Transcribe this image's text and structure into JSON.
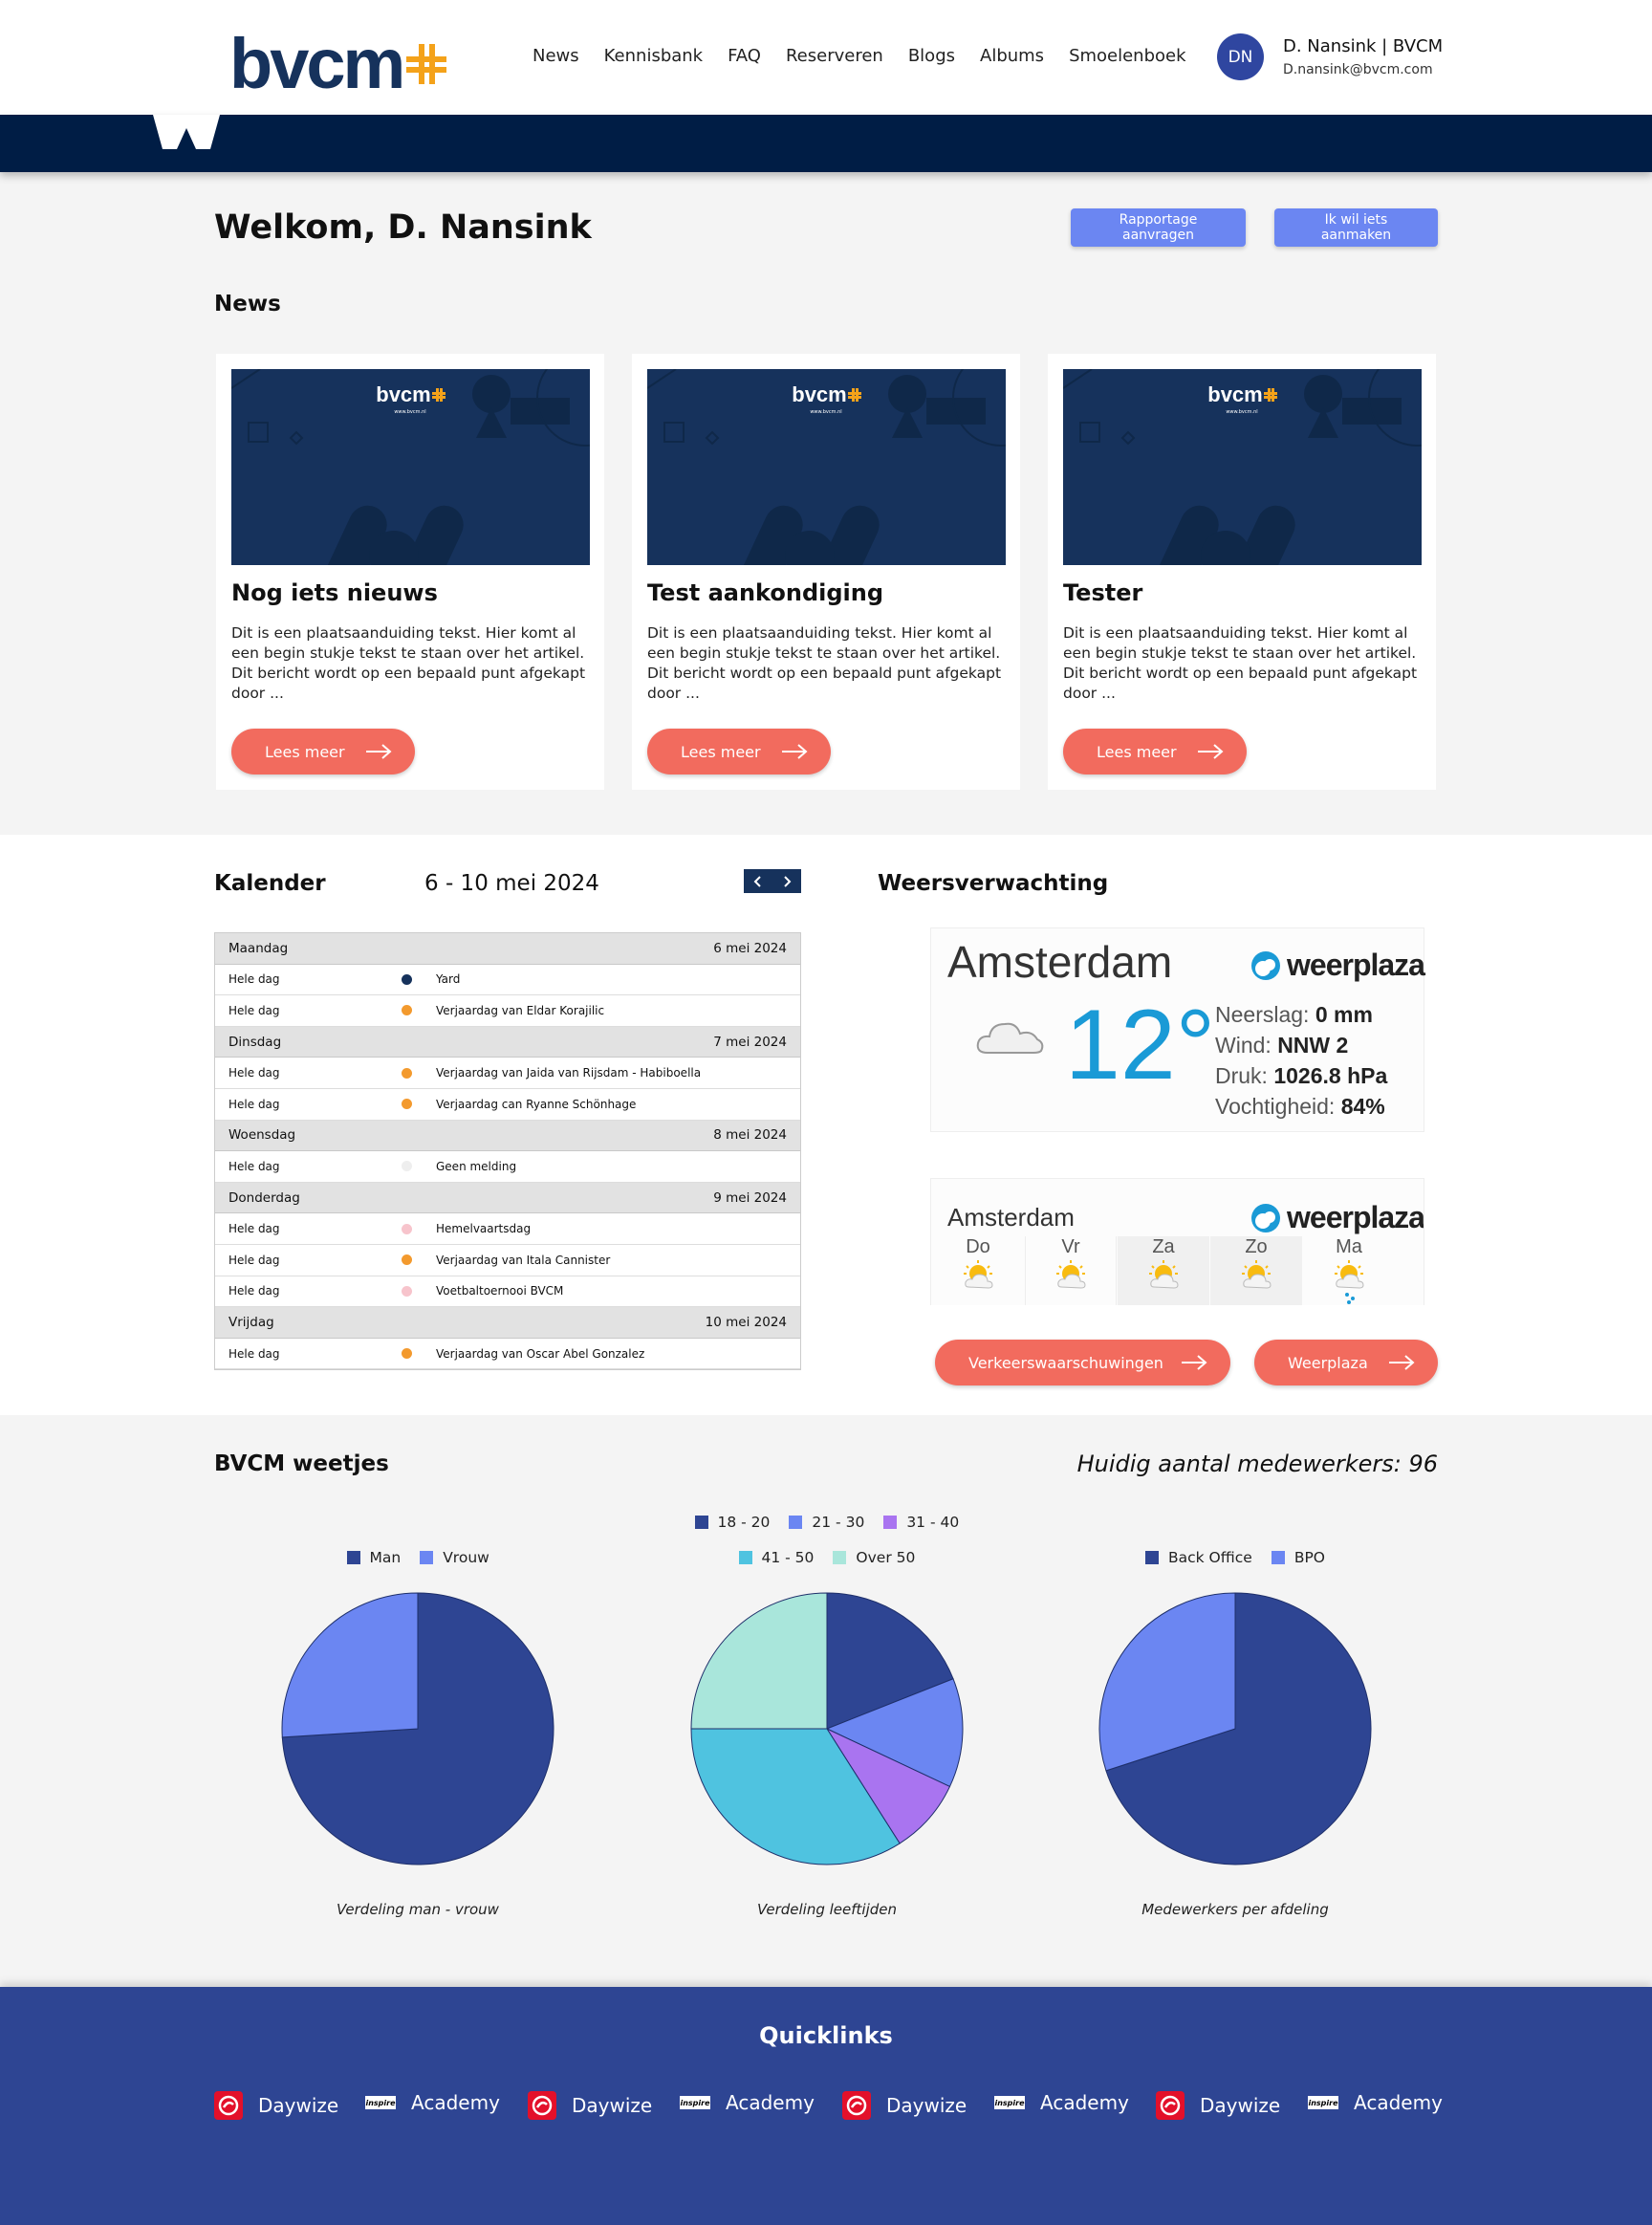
{
  "brand": {
    "logo_text": "bvcm",
    "accent": "#f4a21a",
    "navy": "#16325c"
  },
  "nav": [
    "News",
    "Kennisbank",
    "FAQ",
    "Reserveren",
    "Blogs",
    "Albums",
    "Smoelenboek"
  ],
  "user": {
    "initials": "DN",
    "name": "D. Nansink | BVCM",
    "email": "D.nansink@bvcm.com"
  },
  "welcome": {
    "title": "Welkom, D. Nansink",
    "btn_report": "Rapportage aanvragen",
    "btn_create": "Ik wil iets aanmaken"
  },
  "news": {
    "heading": "News",
    "read_more": "Lees meer",
    "image_caption": "www.bvcm.nl",
    "items": [
      {
        "title": "Nog iets nieuws",
        "text": "Dit is een plaatsaanduiding tekst. Hier komt al een begin stukje tekst te staan over het artikel. Dit bericht wordt op een bepaald punt afgekapt door ..."
      },
      {
        "title": "Test aankondiging",
        "text": "Dit is een plaatsaanduiding tekst. Hier komt al een begin stukje tekst te staan over het artikel. Dit bericht wordt op een bepaald punt afgekapt door ..."
      },
      {
        "title": "Tester",
        "text": "Dit is een plaatsaanduiding tekst. Hier komt al een begin stukje tekst te staan over het artikel. Dit bericht wordt op een bepaald punt afgekapt door ..."
      }
    ]
  },
  "calendar": {
    "heading": "Kalender",
    "range": "6 - 10 mei 2024",
    "rows": [
      {
        "type": "day",
        "day": "Maandag",
        "date": "6 mei 2024"
      },
      {
        "type": "event",
        "when": "Hele dag",
        "color": "#16325c",
        "text": "Yard"
      },
      {
        "type": "event",
        "when": "Hele dag",
        "color": "#f39a2e",
        "text": "Verjaardag van Eldar Korajilic"
      },
      {
        "type": "day",
        "day": "Dinsdag",
        "date": "7 mei 2024"
      },
      {
        "type": "event",
        "when": "Hele dag",
        "color": "#f39a2e",
        "text": "Verjaardag van Jaida van Rijsdam - Habiboella"
      },
      {
        "type": "event",
        "when": "Hele dag",
        "color": "#f39a2e",
        "text": "Verjaardag can Ryanne Schönhage"
      },
      {
        "type": "day",
        "day": "Woensdag",
        "date": "8 mei 2024"
      },
      {
        "type": "event",
        "when": "Hele dag",
        "color": "#eeeeee",
        "text": "Geen melding"
      },
      {
        "type": "day",
        "day": "Donderdag",
        "date": "9 mei 2024"
      },
      {
        "type": "event",
        "when": "Hele dag",
        "color": "#f7c4cc",
        "text": "Hemelvaartsdag"
      },
      {
        "type": "event",
        "when": "Hele dag",
        "color": "#f39a2e",
        "text": "Verjaardag van Itala Cannister"
      },
      {
        "type": "event",
        "when": "Hele dag",
        "color": "#f7c4cc",
        "text": "Voetbaltoernooi BVCM"
      },
      {
        "type": "day",
        "day": "Vrijdag",
        "date": "10 mei 2024"
      },
      {
        "type": "event",
        "when": "Hele dag",
        "color": "#f39a2e",
        "text": "Verjaardag van Oscar Abel Gonzalez"
      }
    ]
  },
  "weather": {
    "heading": "Weersverwachting",
    "city": "Amsterdam",
    "brand": "weerplaza",
    "temp": "12°",
    "stats": [
      {
        "label": "Neerslag:",
        "value": "0 mm"
      },
      {
        "label": "Wind:",
        "value": "NNW 2"
      },
      {
        "label": "Druk:",
        "value": "1026.8 hPa"
      },
      {
        "label": "Vochtigheid:",
        "value": "84%"
      }
    ],
    "forecast": [
      "Do",
      "Vr",
      "Za",
      "Zo",
      "Ma"
    ],
    "btn_traffic": "Verkeerswaarschuwingen",
    "btn_weerplaza": "Weerplaza"
  },
  "weetjes": {
    "heading": "BVCM weetjes",
    "staff_count": "Huidig aantal medewerkers: 96"
  },
  "chart_data": [
    {
      "type": "pie",
      "title": "Verdeling man - vrouw",
      "categories": [
        "Man",
        "Vrouw"
      ],
      "values": [
        74,
        26
      ],
      "colors": [
        "#2e4593",
        "#6b86f2"
      ],
      "legend_position": "top"
    },
    {
      "type": "pie",
      "title": "Verdeling leeftijden",
      "categories": [
        "18 - 20",
        "21 - 30",
        "31 - 40",
        "41 - 50",
        "Over 50"
      ],
      "values": [
        19,
        13,
        9,
        34,
        25
      ],
      "colors": [
        "#2e4593",
        "#6b86f2",
        "#a974f0",
        "#4fc3e0",
        "#a9e6db"
      ],
      "legend_position": "top"
    },
    {
      "type": "pie",
      "title": "Medewerkers per afdeling",
      "categories": [
        "Back Office",
        "BPO"
      ],
      "values": [
        70,
        30
      ],
      "colors": [
        "#2e4593",
        "#6b86f2"
      ],
      "legend_position": "top"
    }
  ],
  "quicklinks": {
    "heading": "Quicklinks",
    "daywize": "Daywize",
    "academy": "Academy",
    "academy_badge": "inspire"
  }
}
